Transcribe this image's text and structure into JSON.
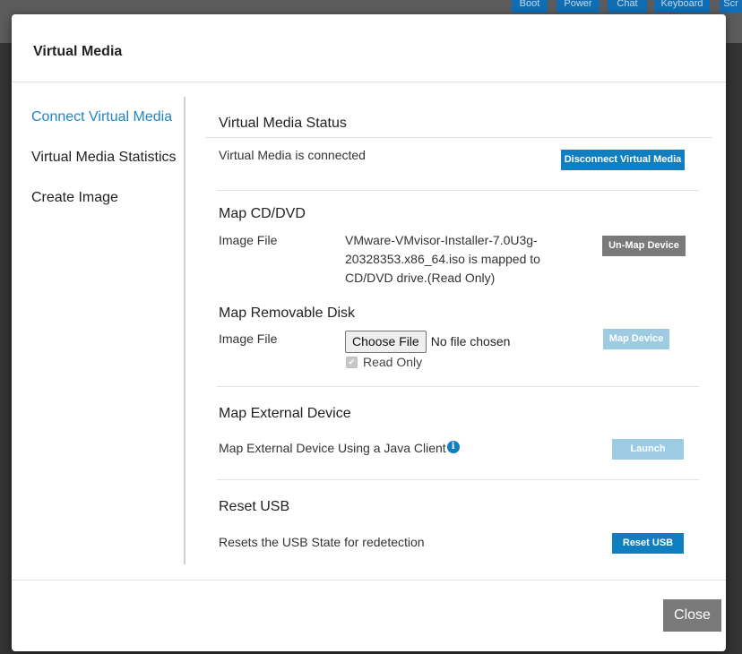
{
  "background": {
    "toolbar": [
      "Boot",
      "Power",
      "Chat",
      "Keyboard",
      "Scr"
    ]
  },
  "modal": {
    "title": "Virtual Media",
    "nav": [
      {
        "label": "Connect Virtual Media",
        "active": true
      },
      {
        "label": "Virtual Media Statistics",
        "active": false
      },
      {
        "label": "Create Image",
        "active": false
      }
    ],
    "status": {
      "title": "Virtual Media Status",
      "text": "Virtual Media is connected",
      "button": "Disconnect Virtual Media"
    },
    "cd_dvd": {
      "title": "Map CD/DVD",
      "label": "Image File",
      "file_lines": [
        "VMware-VMvisor-Installer-7.0U3g-",
        "20328353.x86_64.iso is mapped to",
        "CD/DVD drive.(Read Only)"
      ],
      "button": "Un-Map Device"
    },
    "removable": {
      "title": "Map Removable Disk",
      "label": "Image File",
      "choose_button": "Choose File",
      "no_file": "No file chosen",
      "read_only": "Read Only",
      "button": "Map Device"
    },
    "external": {
      "title": "Map External Device",
      "text": "Map External Device Using a Java Client",
      "info_icon": "i",
      "button": "Launch"
    },
    "reset_usb": {
      "title": "Reset USB",
      "text": "Resets the USB State for redetection",
      "button": "Reset USB"
    },
    "close_button": "Close"
  }
}
